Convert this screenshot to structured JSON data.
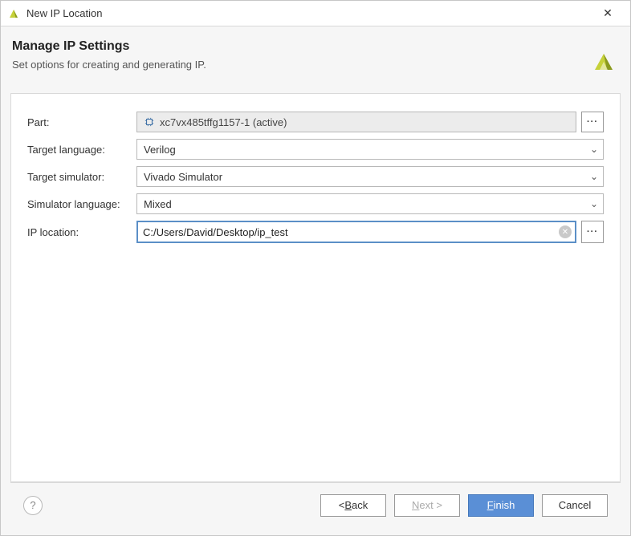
{
  "window": {
    "title": "New IP Location"
  },
  "header": {
    "title": "Manage IP Settings",
    "subtitle": "Set options for creating and generating IP."
  },
  "form": {
    "part": {
      "label": "Part:",
      "value": "xc7vx485tffg1157-1 (active)"
    },
    "target_language": {
      "label": "Target language:",
      "value": "Verilog"
    },
    "target_simulator": {
      "label": "Target simulator:",
      "value": "Vivado Simulator"
    },
    "simulator_language": {
      "label": "Simulator language:",
      "value": "Mixed"
    },
    "ip_location": {
      "label": "IP location:",
      "value": "C:/Users/David/Desktop/ip_test"
    }
  },
  "buttons": {
    "ellipsis": "···",
    "help": "?",
    "back_prefix": "< ",
    "back_ul": "B",
    "back_suffix": "ack",
    "next_ul": "N",
    "next_suffix": "ext >",
    "finish_ul": "F",
    "finish_suffix": "inish",
    "cancel": "Cancel"
  },
  "glyphs": {
    "close": "✕",
    "chevron_down": "⌄",
    "clear": "✕"
  },
  "colors": {
    "accent": "#5a8fd6",
    "logo_dark": "#8a9a1f",
    "logo_light": "#c6d13a"
  }
}
